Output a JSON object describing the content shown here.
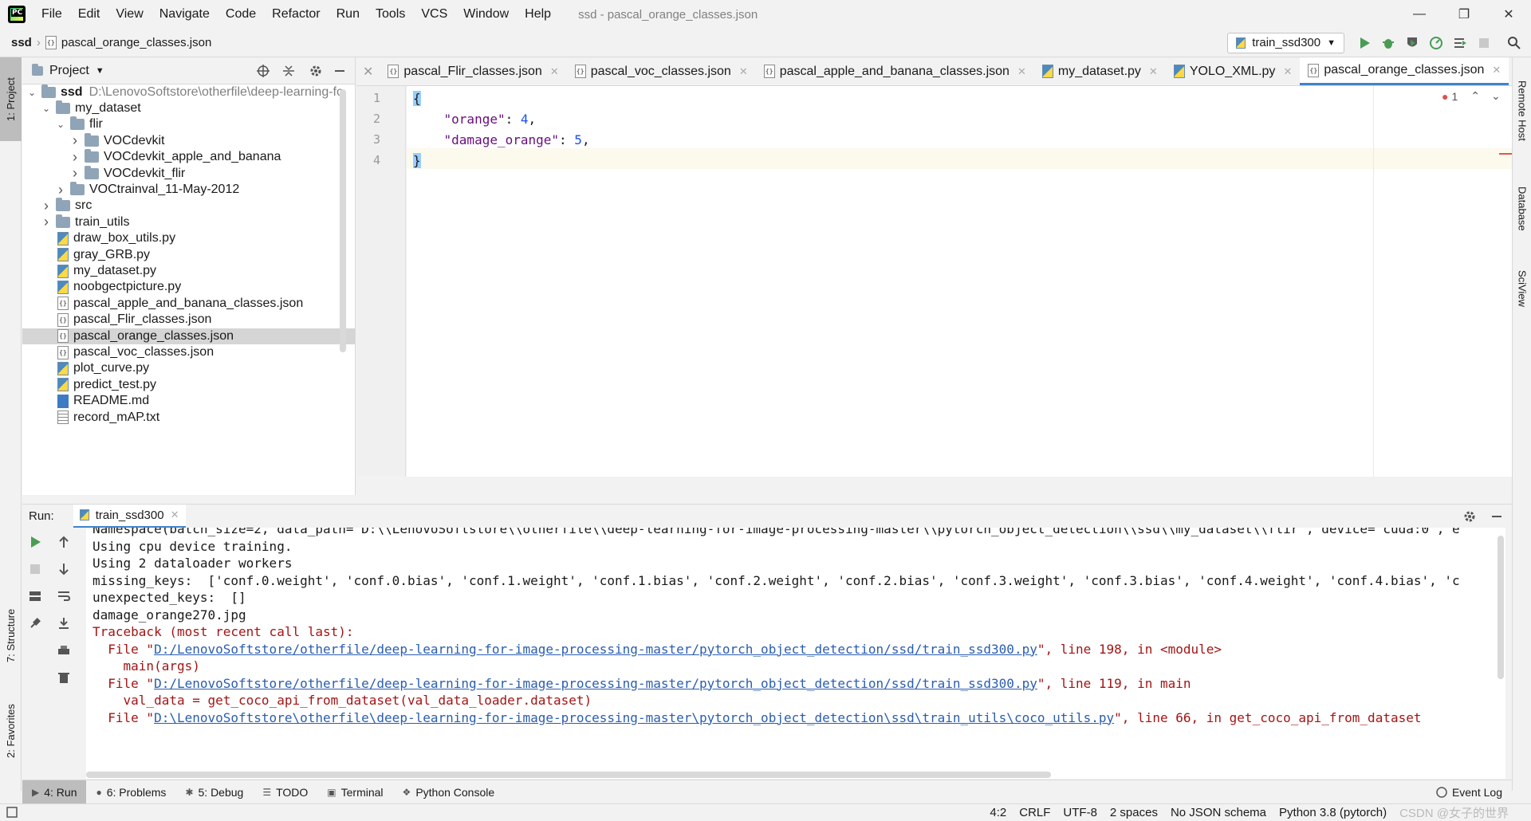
{
  "menubar": {
    "items": [
      "File",
      "Edit",
      "View",
      "Navigate",
      "Code",
      "Refactor",
      "Run",
      "Tools",
      "VCS",
      "Window",
      "Help"
    ],
    "window_title": "ssd - pascal_orange_classes.json"
  },
  "navbar": {
    "project": "ssd",
    "file": "pascal_orange_classes.json",
    "run_config": "train_ssd300"
  },
  "stripes": {
    "left": [
      "1: Project",
      "7: Structure",
      "2: Favorites"
    ],
    "right": [
      "Remote Host",
      "Database",
      "SciView"
    ]
  },
  "project_panel": {
    "title": "Project",
    "root": "ssd",
    "root_path": "D:\\LenovoSoftstore\\otherfile\\deep-learning-fo",
    "tree": [
      {
        "label": "my_dataset",
        "depth": 1,
        "kind": "folder",
        "expanded": true
      },
      {
        "label": "flir",
        "depth": 2,
        "kind": "folder",
        "expanded": true
      },
      {
        "label": "VOCdevkit",
        "depth": 3,
        "kind": "folder",
        "expanded": false
      },
      {
        "label": "VOCdevkit_apple_and_banana",
        "depth": 3,
        "kind": "folder",
        "expanded": false
      },
      {
        "label": "VOCdevkit_flir",
        "depth": 3,
        "kind": "folder",
        "expanded": false
      },
      {
        "label": "VOCtrainval_11-May-2012",
        "depth": 2,
        "kind": "folder",
        "expanded": false
      },
      {
        "label": "src",
        "depth": 1,
        "kind": "folder",
        "expanded": false
      },
      {
        "label": "train_utils",
        "depth": 1,
        "kind": "folder",
        "expanded": false
      },
      {
        "label": "draw_box_utils.py",
        "depth": 1,
        "kind": "py"
      },
      {
        "label": "gray_GRB.py",
        "depth": 1,
        "kind": "py"
      },
      {
        "label": "my_dataset.py",
        "depth": 1,
        "kind": "py"
      },
      {
        "label": "noobgectpicture.py",
        "depth": 1,
        "kind": "py"
      },
      {
        "label": "pascal_apple_and_banana_classes.json",
        "depth": 1,
        "kind": "json"
      },
      {
        "label": "pascal_Flir_classes.json",
        "depth": 1,
        "kind": "json"
      },
      {
        "label": "pascal_orange_classes.json",
        "depth": 1,
        "kind": "json",
        "selected": true
      },
      {
        "label": "pascal_voc_classes.json",
        "depth": 1,
        "kind": "json"
      },
      {
        "label": "plot_curve.py",
        "depth": 1,
        "kind": "py"
      },
      {
        "label": "predict_test.py",
        "depth": 1,
        "kind": "py"
      },
      {
        "label": "README.md",
        "depth": 1,
        "kind": "md"
      },
      {
        "label": "record_mAP.txt",
        "depth": 1,
        "kind": "txt"
      }
    ]
  },
  "editor": {
    "tabs": [
      {
        "label": "pascal_Flir_classes.json",
        "kind": "json"
      },
      {
        "label": "pascal_voc_classes.json",
        "kind": "json"
      },
      {
        "label": "pascal_apple_and_banana_classes.json",
        "kind": "json"
      },
      {
        "label": "my_dataset.py",
        "kind": "py"
      },
      {
        "label": "YOLO_XML.py",
        "kind": "py"
      },
      {
        "label": "pascal_orange_classes.json",
        "kind": "json",
        "active": true
      }
    ],
    "error_count": "1",
    "lines": [
      {
        "no": "1",
        "parts": [
          {
            "t": "{",
            "c": "brace"
          }
        ]
      },
      {
        "no": "2",
        "parts": [
          {
            "t": "    ",
            "c": ""
          },
          {
            "t": "\"orange\"",
            "c": "str"
          },
          {
            "t": ": ",
            "c": ""
          },
          {
            "t": "4",
            "c": "num"
          },
          {
            "t": ",",
            "c": ""
          }
        ]
      },
      {
        "no": "3",
        "parts": [
          {
            "t": "    ",
            "c": ""
          },
          {
            "t": "\"damage_orange\"",
            "c": "str"
          },
          {
            "t": ": ",
            "c": ""
          },
          {
            "t": "5",
            "c": "num"
          },
          {
            "t": ",",
            "c": ""
          }
        ]
      },
      {
        "no": "4",
        "parts": [
          {
            "t": "}",
            "c": "brace"
          }
        ]
      }
    ]
  },
  "run_panel": {
    "label": "Run:",
    "tab": "train_ssd300",
    "console": [
      {
        "t": "Namespace(batch_size=2, data_path='D:\\\\LenovoSoftstore\\\\otherfile\\\\deep-learning-for-image-processing-master\\\\pytorch_object_detection\\\\ssd\\\\my_dataset\\\\flir', device='cuda:0', e",
        "kind": "out"
      },
      {
        "t": "Using cpu device training.",
        "kind": "out"
      },
      {
        "t": "Using 2 dataloader workers",
        "kind": "out"
      },
      {
        "t": "missing_keys:  ['conf.0.weight', 'conf.0.bias', 'conf.1.weight', 'conf.1.bias', 'conf.2.weight', 'conf.2.bias', 'conf.3.weight', 'conf.3.bias', 'conf.4.weight', 'conf.4.bias', 'c",
        "kind": "out"
      },
      {
        "t": "unexpected_keys:  []",
        "kind": "out"
      },
      {
        "t": "damage_orange270.jpg",
        "kind": "out"
      },
      {
        "t": "Traceback (most recent call last):",
        "kind": "err"
      },
      {
        "pre": "  File \"",
        "link": "D:/LenovoSoftstore/otherfile/deep-learning-for-image-processing-master/pytorch_object_detection/ssd/train_ssd300.py",
        "post": "\", line 198, in <module>",
        "kind": "err"
      },
      {
        "t": "    main(args)",
        "kind": "err"
      },
      {
        "pre": "  File \"",
        "link": "D:/LenovoSoftstore/otherfile/deep-learning-for-image-processing-master/pytorch_object_detection/ssd/train_ssd300.py",
        "post": "\", line 119, in main",
        "kind": "err"
      },
      {
        "t": "    val_data = get_coco_api_from_dataset(val_data_loader.dataset)",
        "kind": "err"
      },
      {
        "pre": "  File \"",
        "link": "D:\\LenovoSoftstore\\otherfile\\deep-learning-for-image-processing-master\\pytorch_object_detection\\ssd\\train_utils\\coco_utils.py",
        "post": "\", line 66, in get_coco_api_from_dataset",
        "kind": "err"
      }
    ]
  },
  "bottom_tools": [
    {
      "label": "4: Run",
      "icon": "play-icon",
      "active": true
    },
    {
      "label": "6: Problems",
      "icon": "problems-icon"
    },
    {
      "label": "5: Debug",
      "icon": "bug-icon"
    },
    {
      "label": "TODO",
      "icon": "todo-icon"
    },
    {
      "label": "Terminal",
      "icon": "terminal-icon"
    },
    {
      "label": "Python Console",
      "icon": "python-icon"
    }
  ],
  "event_log": "Event Log",
  "statusbar": {
    "position": "4:2",
    "line_sep": "CRLF",
    "encoding": "UTF-8",
    "indent": "2 spaces",
    "schema": "No JSON schema",
    "interpreter": "Python 3.8 (pytorch)",
    "watermark": "CSDN @女子的世界"
  },
  "colors": {
    "accent": "#4083c9",
    "error": "#a31515",
    "link": "#2a5db0",
    "run_green": "#499c54"
  }
}
